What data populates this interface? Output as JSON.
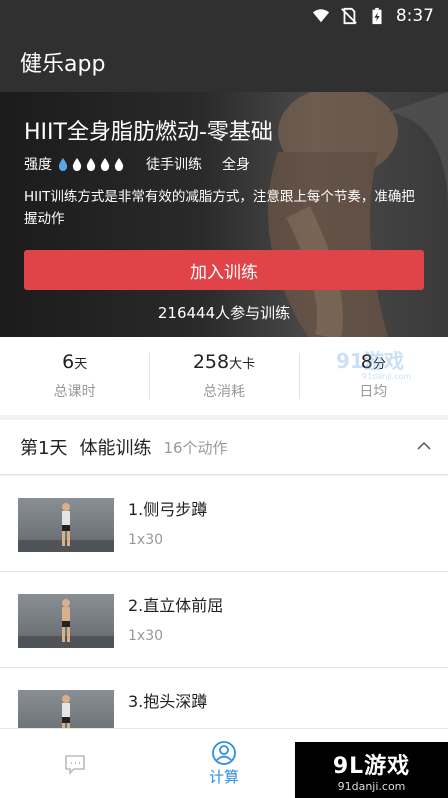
{
  "status": {
    "time": "8:37",
    "icons": [
      "wifi-icon",
      "no-sim-icon",
      "battery-charging-icon"
    ]
  },
  "app": {
    "title": "健乐app"
  },
  "course": {
    "title": "HIIT全身脂肪燃动-零基础",
    "intensity_label": "强度",
    "intensity_level": 1,
    "intensity_max": 5,
    "equipment": "徒手训练",
    "body_part": "全身",
    "description": "HIIT训练方式是非常有效的减脂方式，注意跟上每个节奏，准确把握动作",
    "join_label": "加入训练",
    "participants": "216444人参与训练"
  },
  "stats": [
    {
      "value": "6",
      "unit": "天",
      "label": "总课时"
    },
    {
      "value": "258",
      "unit": "大卡",
      "label": "总消耗"
    },
    {
      "value": "8",
      "unit": "分",
      "label": "日均"
    }
  ],
  "watermark_small": {
    "text": "91游戏",
    "sub": "91danji.com"
  },
  "day": {
    "title": "第1天",
    "name": "体能训练",
    "count": "16个动作"
  },
  "exercises": [
    {
      "name": "1.侧弓步蹲",
      "reps": "1x30"
    },
    {
      "name": "2.直立体前屈",
      "reps": "1x30"
    },
    {
      "name": "3.抱头深蹲",
      "reps": ""
    }
  ],
  "nav": [
    {
      "label": "",
      "icon": "message-icon"
    },
    {
      "label": "计算",
      "icon": "user-circle-icon"
    },
    {
      "label": "",
      "icon": "compass-icon"
    }
  ],
  "watermark_big": {
    "text": "9L游戏",
    "sub": "91danji.com"
  },
  "colors": {
    "accent": "#e04448",
    "nav_active": "#2a8fe0",
    "drop": "#5aa7e6"
  }
}
